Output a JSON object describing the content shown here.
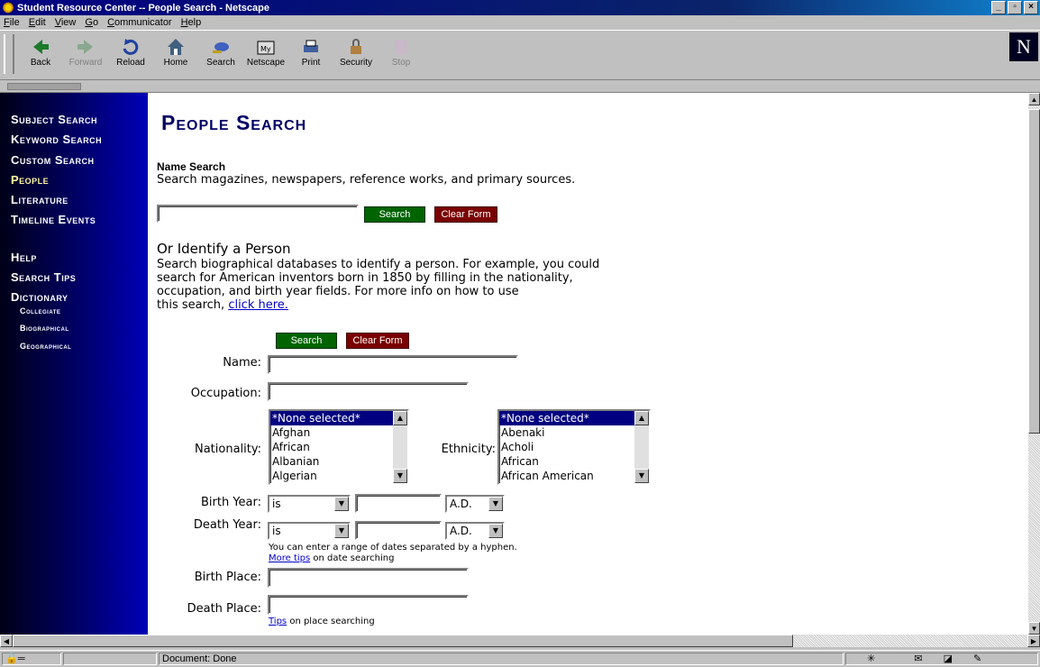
{
  "window": {
    "title": "Student Resource Center -- People Search - Netscape"
  },
  "menu": [
    "File",
    "Edit",
    "View",
    "Go",
    "Communicator",
    "Help"
  ],
  "toolbar": {
    "back": "Back",
    "forward": "Forward",
    "reload": "Reload",
    "home": "Home",
    "search": "Search",
    "netscape": "Netscape",
    "print": "Print",
    "security": "Security",
    "stop": "Stop"
  },
  "sidebar": {
    "items": [
      "Subject Search",
      "Keyword Search",
      "Custom Search",
      "People",
      "Literature",
      "Timeline Events",
      "Help",
      "Search Tips",
      "Dictionary"
    ],
    "sub": [
      "Collegiate",
      "Biographical",
      "Geographical"
    ]
  },
  "page": {
    "title": "People Search",
    "name_search_heading": "Name Search",
    "name_search_desc": "Search magazines, newspapers, reference works, and primary sources.",
    "search_btn": "Search",
    "clear_btn": "Clear Form",
    "identify_heading": "Or Identify a Person",
    "identify_desc_1": "Search biographical databases to identify a person. For example, you could",
    "identify_desc_2": "search for American inventors born in 1850 by filling in the nationality,",
    "identify_desc_3": "occupation, and birth year fields. For more info on how to use",
    "identify_desc_4": "this search,",
    "click_here": "click here.",
    "labels": {
      "name": "Name:",
      "occupation": "Occupation:",
      "nationality": "Nationality:",
      "ethnicity": "Ethnicity:",
      "birth_year": "Birth Year:",
      "death_year": "Death Year:",
      "birth_place": "Birth Place:",
      "death_place": "Death Place:"
    },
    "nationality_options": [
      "*None selected*",
      "Afghan",
      "African",
      "Albanian",
      "Algerian"
    ],
    "ethnicity_options": [
      "*None selected*",
      "Abenaki",
      "Acholi",
      "African",
      "African American"
    ],
    "year_op": "is",
    "era": "A.D.",
    "date_note": "You can enter a range of dates separated by a hyphen.",
    "more_tips": "More tips",
    "date_note_2": " on date searching",
    "tips": "Tips",
    "place_note": " on place searching"
  },
  "status": {
    "text": "Document: Done"
  }
}
